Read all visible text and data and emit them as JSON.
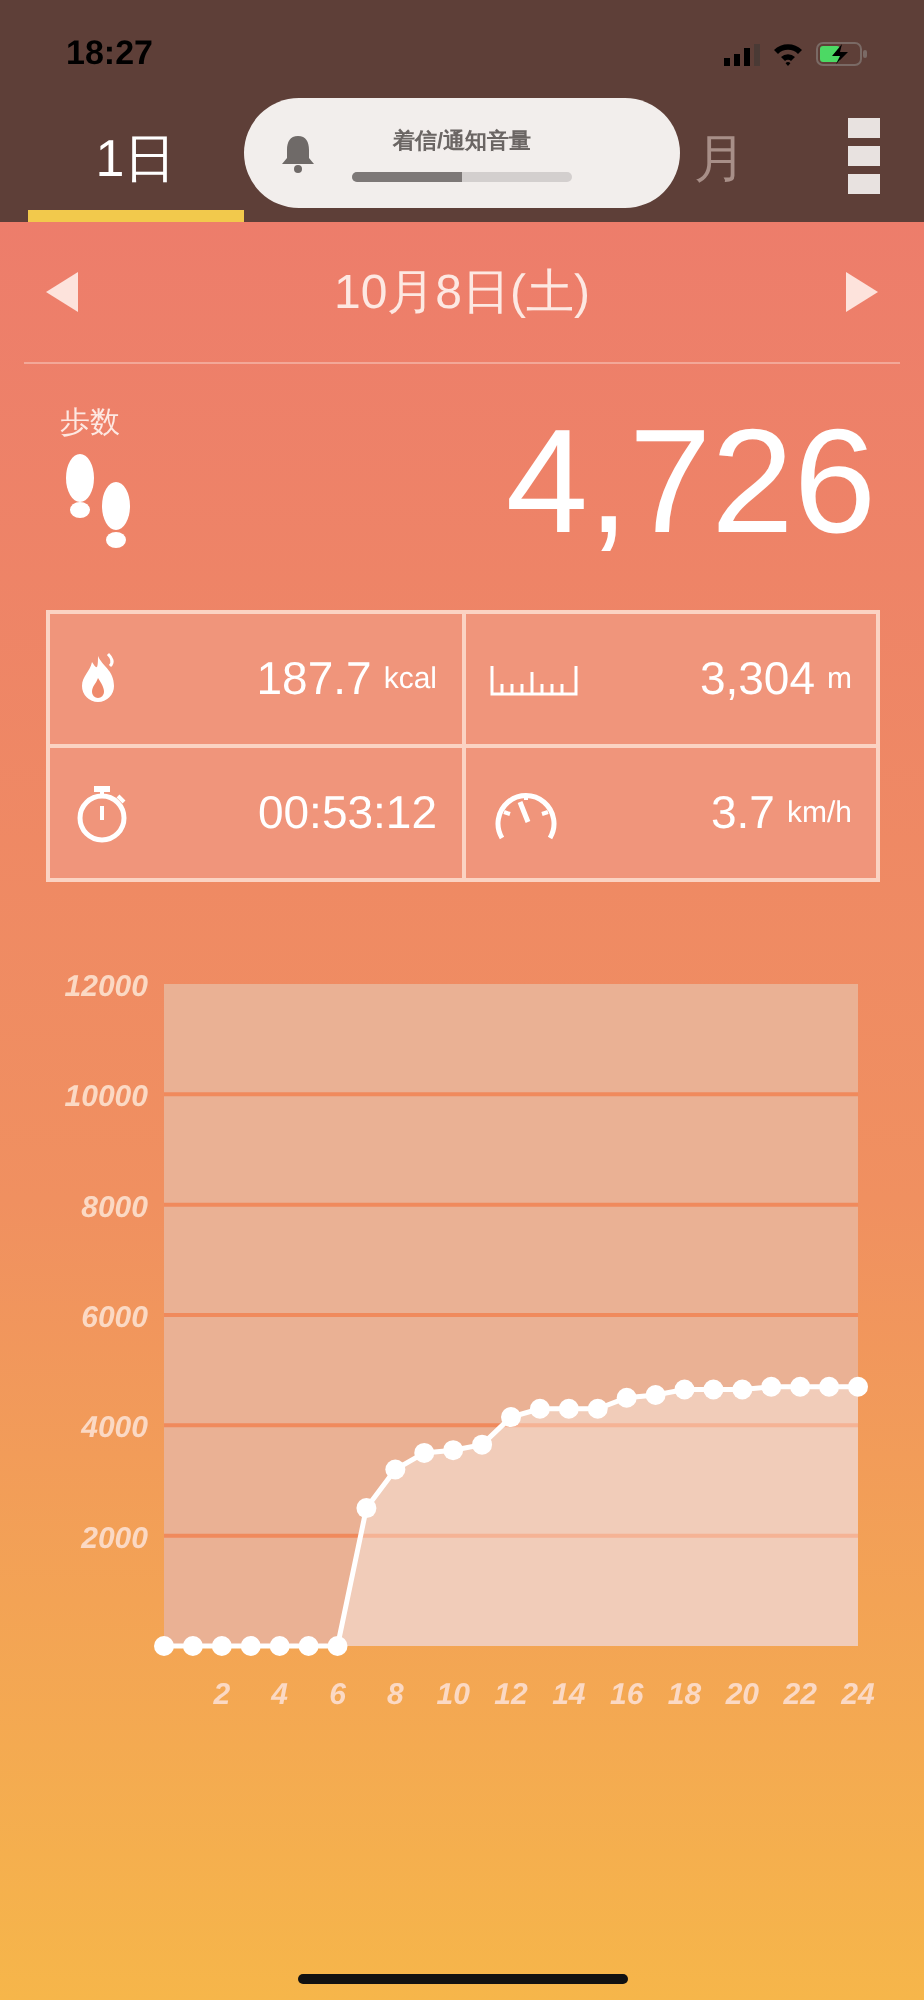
{
  "status_bar": {
    "time": "18:27"
  },
  "tabs": [
    {
      "label": "1日",
      "selected": true
    },
    {
      "label": "月",
      "selected": false
    }
  ],
  "volume_hud": {
    "title": "着信/通知音量",
    "level": 0.5
  },
  "date_nav": {
    "date": "10月8日(土)"
  },
  "steps": {
    "label": "歩数",
    "value": "4,726"
  },
  "stats": [
    {
      "kind": "calories",
      "value": "187.7",
      "unit": "kcal"
    },
    {
      "kind": "distance",
      "value": "3,304",
      "unit": "m"
    },
    {
      "kind": "duration",
      "value": "00:53:12"
    },
    {
      "kind": "speed",
      "value": "3.7",
      "unit": "km/h"
    }
  ],
  "chart": {
    "chart_data": {
      "type": "area",
      "x": [
        0,
        1,
        2,
        3,
        4,
        5,
        6,
        7,
        8,
        9,
        10,
        11,
        12,
        13,
        14,
        15,
        16,
        17,
        18,
        19,
        20,
        21,
        22,
        23,
        24
      ],
      "series": [
        {
          "color": "#ffffff",
          "values": [
            0,
            0,
            0,
            0,
            0,
            0,
            0,
            2500,
            3200,
            3500,
            3550,
            3650,
            4150,
            4300,
            4300,
            4300,
            4500,
            4550,
            4650,
            4650,
            4650,
            4700,
            4700,
            4700,
            4700
          ]
        }
      ],
      "grid": true,
      "xlim": [
        0,
        24
      ],
      "ylim": [
        0,
        12000
      ],
      "xticks": [
        2,
        4,
        6,
        8,
        10,
        12,
        14,
        16,
        18,
        20,
        22,
        24
      ],
      "yticks": [
        2000,
        4000,
        6000,
        8000,
        10000,
        12000
      ]
    }
  }
}
